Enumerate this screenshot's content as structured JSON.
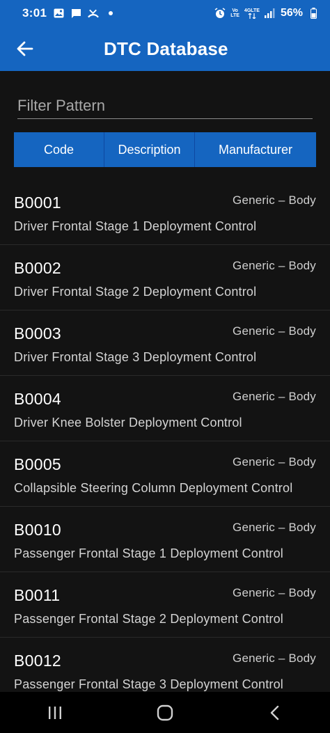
{
  "status_bar": {
    "time": "3:01",
    "network_top": "Vo",
    "network_bottom": "LTE",
    "network_type": "4GLTE",
    "battery": "56%"
  },
  "app_bar": {
    "title": "DTC Database"
  },
  "filter": {
    "placeholder": "Filter Pattern",
    "value": ""
  },
  "sort_buttons": [
    {
      "label": "Code"
    },
    {
      "label": "Description"
    },
    {
      "label": "Manufacturer"
    }
  ],
  "codes": [
    {
      "code": "B0001",
      "category": "Generic – Body",
      "description": "Driver Frontal Stage 1 Deployment Control"
    },
    {
      "code": "B0002",
      "category": "Generic – Body",
      "description": "Driver Frontal Stage 2 Deployment Control"
    },
    {
      "code": "B0003",
      "category": "Generic – Body",
      "description": "Driver Frontal Stage 3 Deployment Control"
    },
    {
      "code": "B0004",
      "category": "Generic – Body",
      "description": "Driver Knee Bolster Deployment Control"
    },
    {
      "code": "B0005",
      "category": "Generic – Body",
      "description": "Collapsible Steering Column Deployment Control"
    },
    {
      "code": "B0010",
      "category": "Generic – Body",
      "description": "Passenger Frontal Stage 1 Deployment Control"
    },
    {
      "code": "B0011",
      "category": "Generic – Body",
      "description": "Passenger Frontal Stage 2 Deployment Control"
    },
    {
      "code": "B0012",
      "category": "Generic – Body",
      "description": "Passenger Frontal Stage 3 Deployment Control"
    }
  ],
  "colors": {
    "accent": "#1565c0",
    "background": "#131313"
  }
}
